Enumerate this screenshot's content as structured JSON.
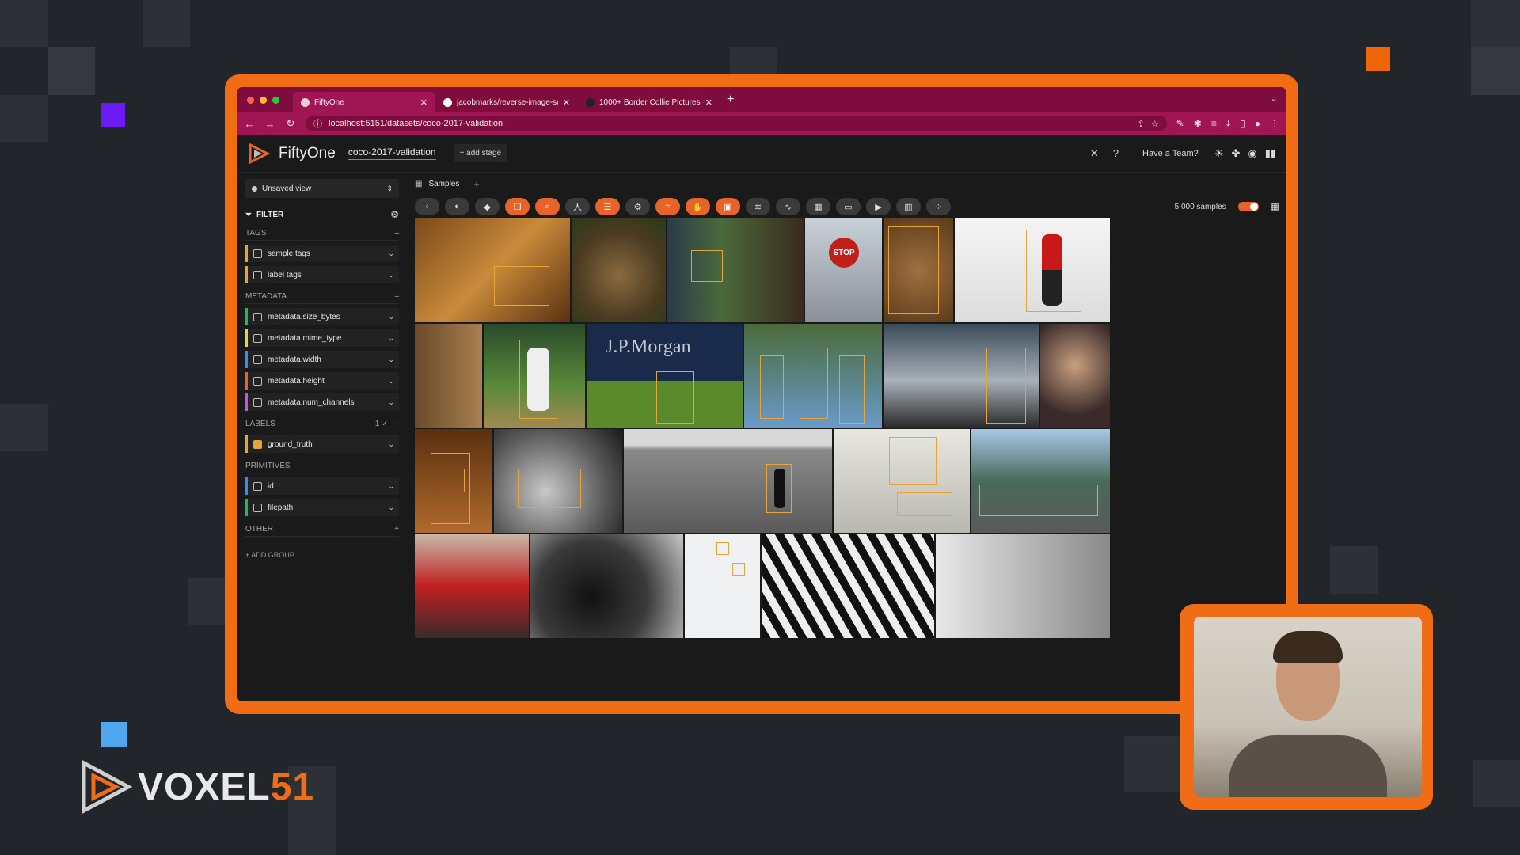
{
  "browser": {
    "tabs": [
      {
        "title": "FiftyOne",
        "active": true
      },
      {
        "title": "jacobmarks/reverse-image-se",
        "active": false
      },
      {
        "title": "1000+ Border Collie Pictures",
        "active": false
      }
    ],
    "url": "localhost:5151/datasets/coco-2017-validation"
  },
  "app": {
    "name": "FiftyOne",
    "dataset": "coco-2017-validation",
    "add_stage": "+ add stage",
    "have_team": "Have a Team?"
  },
  "sidebar": {
    "view": "Unsaved view",
    "filter_label": "FILTER",
    "groups": {
      "tags": "TAGS",
      "metadata": "METADATA",
      "labels": "LABELS",
      "labels_count": "1 ✓",
      "primitives": "PRIMITIVES",
      "other": "OTHER"
    },
    "items": {
      "sample_tags": "sample tags",
      "label_tags": "label tags",
      "size_bytes": "metadata.size_bytes",
      "mime_type": "metadata.mime_type",
      "width": "metadata.width",
      "height": "metadata.height",
      "num_channels": "metadata.num_channels",
      "ground_truth": "ground_truth",
      "id": "id",
      "filepath": "filepath"
    },
    "add_group": "+ ADD GROUP"
  },
  "main": {
    "samples_tab": "Samples",
    "sample_count": "5,000 samples"
  },
  "gallery_text": {
    "jpmorgan": "J.P.Morgan",
    "stop": "STOP"
  },
  "brand": {
    "name": "VOXEL",
    "number": "51"
  },
  "colors": {
    "accent": "#f06d16",
    "tab_bar": "#7e0d3e",
    "bbox": "#e8a33a"
  }
}
